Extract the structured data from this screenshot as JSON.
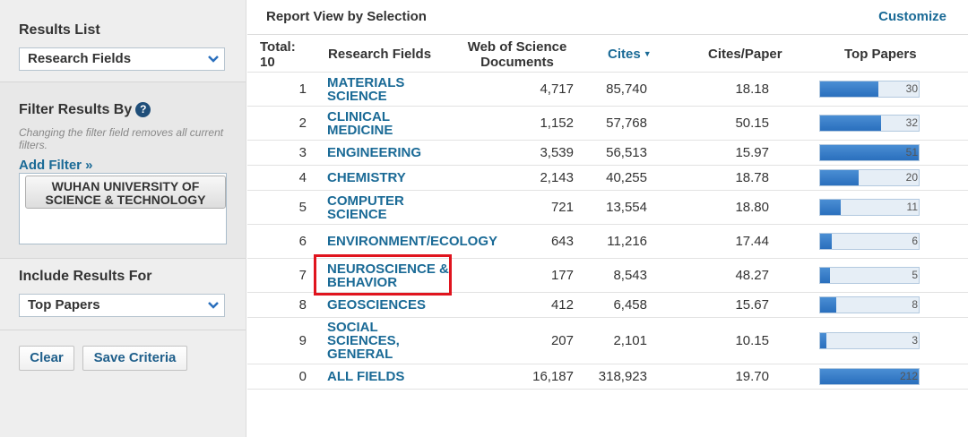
{
  "sidebar": {
    "results_list": {
      "title": "Results List",
      "selected": "Research Fields"
    },
    "filter": {
      "title": "Filter Results By",
      "hint": "Changing the filter field removes all current filters.",
      "add_filter": "Add Filter »",
      "chip": "WUHAN UNIVERSITY OF SCIENCE & TECHNOLOGY"
    },
    "include": {
      "title": "Include Results For",
      "selected": "Top Papers"
    },
    "buttons": {
      "clear": "Clear",
      "save": "Save Criteria"
    }
  },
  "report": {
    "title": "Report View by Selection",
    "customize": "Customize",
    "headers": {
      "total": "Total: 10",
      "field": "Research Fields",
      "docs": "Web of Science Documents",
      "cites": "Cites",
      "cites_paper": "Cites/Paper",
      "top_papers": "Top Papers"
    },
    "rows": [
      {
        "rank": "1",
        "field": "MATERIALS SCIENCE",
        "docs": "4,717",
        "cites": "85,740",
        "cpp": "18.18",
        "top": "30",
        "fill": 0.59
      },
      {
        "rank": "2",
        "field": "CLINICAL MEDICINE",
        "docs": "1,152",
        "cites": "57,768",
        "cpp": "50.15",
        "top": "32",
        "fill": 0.62
      },
      {
        "rank": "3",
        "field": "ENGINEERING",
        "docs": "3,539",
        "cites": "56,513",
        "cpp": "15.97",
        "top": "51",
        "fill": 1.0
      },
      {
        "rank": "4",
        "field": "CHEMISTRY",
        "docs": "2,143",
        "cites": "40,255",
        "cpp": "18.78",
        "top": "20",
        "fill": 0.39
      },
      {
        "rank": "5",
        "field": "COMPUTER SCIENCE",
        "docs": "721",
        "cites": "13,554",
        "cpp": "18.80",
        "top": "11",
        "fill": 0.21
      },
      {
        "rank": "6",
        "field": "ENVIRONMENT/ECOLOGY",
        "docs": "643",
        "cites": "11,216",
        "cpp": "17.44",
        "top": "6",
        "fill": 0.12
      },
      {
        "rank": "7",
        "field": "NEUROSCIENCE & BEHAVIOR",
        "docs": "177",
        "cites": "8,543",
        "cpp": "48.27",
        "top": "5",
        "fill": 0.1
      },
      {
        "rank": "8",
        "field": "GEOSCIENCES",
        "docs": "412",
        "cites": "6,458",
        "cpp": "15.67",
        "top": "8",
        "fill": 0.16
      },
      {
        "rank": "9",
        "field": "SOCIAL SCIENCES, GENERAL",
        "docs": "207",
        "cites": "2,101",
        "cpp": "10.15",
        "top": "3",
        "fill": 0.06
      },
      {
        "rank": "0",
        "field": "ALL FIELDS",
        "docs": "16,187",
        "cites": "318,923",
        "cpp": "19.70",
        "top": "212",
        "fill": 1.0
      }
    ]
  },
  "colors": {
    "link": "#1a6a96",
    "bar": "#2a6fbd",
    "highlight": "#e0141e"
  },
  "icons": {
    "dropdown": "chevron-down-icon",
    "help": "help-icon",
    "sort": "sort-desc-icon"
  }
}
